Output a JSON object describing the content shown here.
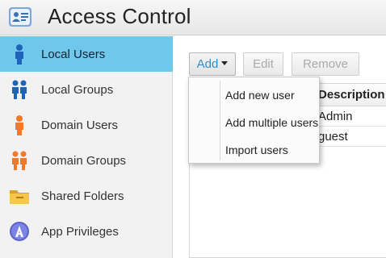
{
  "app": {
    "title": "Access Control",
    "icon": "id-card-icon"
  },
  "sidebar": {
    "items": [
      {
        "label": "Local Users",
        "icon": "user-icon",
        "active": true
      },
      {
        "label": "Local Groups",
        "icon": "user-group-icon"
      },
      {
        "label": "Domain Users",
        "icon": "domain-user-icon"
      },
      {
        "label": "Domain Groups",
        "icon": "domain-group-icon"
      },
      {
        "label": "Shared Folders",
        "icon": "folder-icon"
      },
      {
        "label": "App Privileges",
        "icon": "app-privileges-icon"
      }
    ]
  },
  "toolbar": {
    "add_label": "Add",
    "edit_label": "Edit",
    "remove_label": "Remove"
  },
  "table": {
    "columns": [
      "Description"
    ],
    "rows": [
      {
        "description": "Admin"
      },
      {
        "description": "guest"
      }
    ]
  },
  "add_menu": {
    "items": [
      "Add new user",
      "Add multiple users",
      "Import users"
    ]
  },
  "colors": {
    "active_item": "#6fc7ec",
    "accent": "#2a8fd0"
  }
}
